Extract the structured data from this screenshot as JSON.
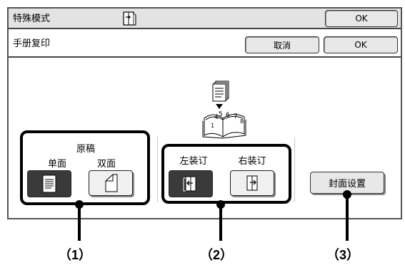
{
  "header": {
    "title": "特殊模式",
    "ok_label": "OK",
    "mode_icon": "booklet-icon"
  },
  "subheader": {
    "title": "手册复印",
    "cancel_label": "取消",
    "ok_label": "OK"
  },
  "original_group": {
    "title": "原稿",
    "one_sided_label": "单面",
    "two_sided_label": "双面",
    "selected": "单面"
  },
  "binding_group": {
    "left_label": "左装订",
    "right_label": "右装订",
    "selected": "左装订"
  },
  "cover": {
    "label": "封面设置"
  },
  "illustration": {
    "page_numbers": [
      "1",
      "4",
      "5",
      "6",
      "7",
      "8"
    ]
  },
  "callouts": [
    "（1）",
    "（2）",
    "（3）"
  ]
}
